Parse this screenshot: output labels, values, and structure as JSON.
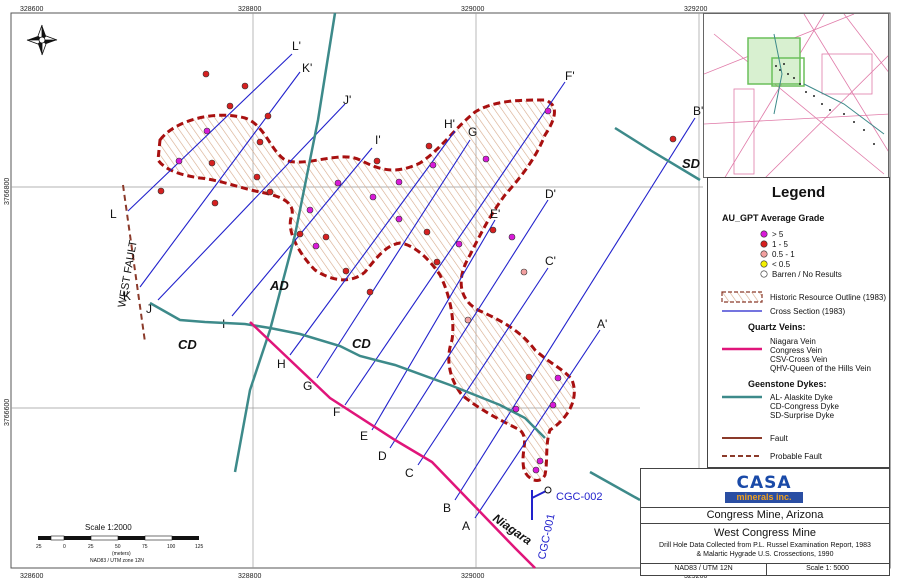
{
  "map": {
    "grid_x_labels": [
      "328600",
      "328800",
      "329000",
      "329200"
    ],
    "grid_y_labels": [
      "3766800",
      "3766600"
    ],
    "section_start_labels": [
      "L",
      "K",
      "J",
      "I",
      "H",
      "G",
      "F",
      "E",
      "D",
      "C",
      "B",
      "A"
    ],
    "section_end_labels": [
      "L'",
      "K'",
      "J'",
      "I'",
      "H'",
      "G",
      "F'",
      "E'",
      "D'",
      "C'",
      "B'",
      "A'"
    ],
    "dyke_labels": [
      "CD",
      "CD",
      "AD",
      "SD"
    ],
    "fault_label": "WEST FAULT",
    "vein_label": "Niagara",
    "hole_labels": [
      "CGC-002",
      "CGC-001"
    ]
  },
  "legend": {
    "title": "Legend",
    "grade_heading": "AU_GPT Average Grade",
    "grade_items": [
      {
        "label": "> 5",
        "color": "#d81ad8"
      },
      {
        "label": "1 - 5",
        "color": "#d62020"
      },
      {
        "label": "0.5 - 1",
        "color": "#f2a0a0"
      },
      {
        "label": "< 0.5",
        "color": "#f4f000"
      },
      {
        "label": "Barren / No Results",
        "color": "#ffffff"
      }
    ],
    "historic_outline": "Historic Resource Outline (1983)",
    "cross_section": "Cross Section (1983)",
    "quartz_heading": "Quartz Veins:",
    "quartz_items": [
      "Niagara Vein",
      "Congress Vein",
      "CSV-Cross Vein",
      "QHV-Queen of the Hills Vein"
    ],
    "dyke_heading": "Geenstone Dykes:",
    "dyke_items": [
      "AL- Alaskite Dyke",
      "CD-Congress Dyke",
      "SD-Surprise Dyke"
    ],
    "fault": "Fault",
    "probable_fault": "Probable Fault",
    "colors": {
      "vein": "#e0157a",
      "dyke": "#3d8a8a",
      "fault": "#8b3a2a",
      "outline": "#a81010",
      "section": "#2222cc"
    }
  },
  "titlebox": {
    "logo_top": "CASA",
    "logo_bottom": "minerals inc.",
    "location": "Congress Mine, Arizona",
    "project": "West Congress Mine",
    "source_line1": "Drill Hole Data Collected  from P.L. Russel Examination Report, 1983",
    "source_line2": "& Malartic Hygrade U.S. Crossections, 1990",
    "datum": "NAD83 / UTM 12N",
    "scale": "Scale 1: 5000"
  },
  "scalebar": {
    "title": "Scale 1:2000",
    "ticks": [
      "25",
      "0",
      "25",
      "50",
      "75",
      "100",
      "125"
    ],
    "units": "(meters)",
    "datum": "NAD83 / UTM zone 12N"
  }
}
